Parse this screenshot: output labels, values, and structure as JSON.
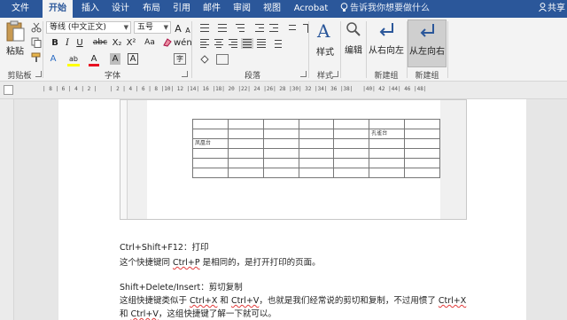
{
  "tabs": [
    {
      "label": "文件"
    },
    {
      "label": "开始"
    },
    {
      "label": "插入"
    },
    {
      "label": "设计"
    },
    {
      "label": "布局"
    },
    {
      "label": "引用"
    },
    {
      "label": "邮件"
    },
    {
      "label": "审阅"
    },
    {
      "label": "视图"
    },
    {
      "label": "Acrobat"
    }
  ],
  "tell_me": "告诉我你想要做什么",
  "share": "共享",
  "ribbon": {
    "clipboard": {
      "paste": "粘贴",
      "label": "剪贴板"
    },
    "font": {
      "font_name": "等线 (中文正文)",
      "font_size": "五号",
      "label": "字体",
      "bold": "B",
      "italic": "I",
      "underline": "U",
      "strike": "abc",
      "subscript": "X₂",
      "superscript": "X²",
      "change_case": "Aa",
      "grow": "A",
      "shrink": "A",
      "text_effects": "A",
      "highlight": "ab",
      "font_color": "A",
      "char_shade": "A",
      "char_border": "A",
      "wen": "wén",
      "enclose": "字"
    },
    "paragraph": {
      "label": "段落"
    },
    "styles": {
      "label": "样式",
      "button": "样式"
    },
    "editing": {
      "button": "编辑"
    },
    "new_group_1": {
      "label": "新建组",
      "button": "从右向左"
    },
    "new_group_2": {
      "label": "新建组",
      "button": "从左向右"
    }
  },
  "ruler": {
    "marks": "| 8 | 6 | 4 | 2 |    | 2 | 4 | 6 | 8 |10| 12 |14| 16 |18| 20 |22| 24 |26| 28 |30| 32 |34| 36 |38|   |40| 42 |44| 46 |48|"
  },
  "embedded_table": {
    "rows": [
      [
        "",
        "",
        "",
        "",
        "",
        "",
        ""
      ],
      [
        "",
        "",
        "",
        "",
        "",
        "孔雀台",
        ""
      ],
      [
        "凤凰台",
        "",
        "",
        "",
        "",
        "",
        ""
      ],
      [
        "",
        "",
        "",
        "",
        "",
        "",
        ""
      ],
      [
        "",
        "",
        "",
        "",
        "",
        "",
        ""
      ],
      [
        "",
        "",
        "",
        "",
        "",
        "",
        ""
      ]
    ]
  },
  "body": {
    "l1": "Ctrl+Shift+F12：打印",
    "l2_a": "这个快捷键同 ",
    "l2_b": "Ctrl+P",
    "l2_c": " 是相同的，是打开打印的页面。",
    "l3": "Shift+Delete/Insert：剪切复制",
    "l4_a": "这组快捷键类似于 ",
    "l4_b": "Ctrl+X",
    "l4_c": " 和 ",
    "l4_d": "Ctrl+V",
    "l4_e": "，也就是我们经常说的剪切和复制，不过用惯了 ",
    "l4_f": "Ctrl+X",
    "l5_a": "和 ",
    "l5_b": "Ctrl+V",
    "l5_c": "，这组快捷键了解一下就可以。"
  },
  "colors": {
    "title_bar": "#2b579a",
    "ribbon_bg": "#f3f3f3",
    "font_color_bar": "#e81123",
    "highlight_bar": "#ffff00",
    "canvas": "#e6e6e6"
  }
}
